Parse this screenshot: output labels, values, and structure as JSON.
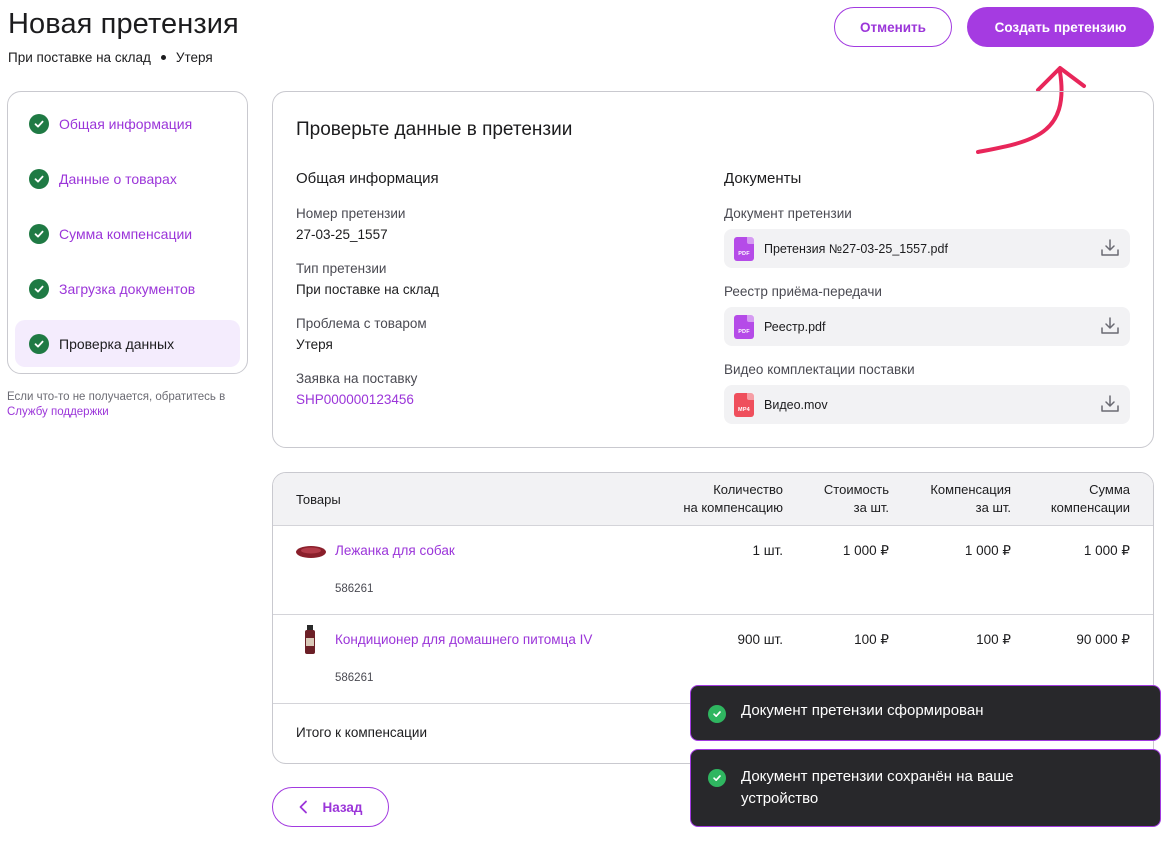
{
  "header": {
    "title": "Новая претензия",
    "subtitle_type": "При поставке на склад",
    "subtitle_problem": "Утеря",
    "cancel_label": "Отменить",
    "create_label": "Создать претензию"
  },
  "steps": [
    {
      "label": "Общая информация",
      "done": true
    },
    {
      "label": "Данные о товарах",
      "done": true
    },
    {
      "label": "Сумма компенсации",
      "done": true
    },
    {
      "label": "Загрузка документов",
      "done": true
    },
    {
      "label": "Проверка данных",
      "done": true,
      "active": true
    }
  ],
  "help": {
    "text": "Если что-то не получается, обратитесь в ",
    "link": "Службу поддержки"
  },
  "review": {
    "title": "Проверьте данные в претензии",
    "general": {
      "title": "Общая информация",
      "claim_number_label": "Номер претензии",
      "claim_number": "27-03-25_1557",
      "claim_type_label": "Тип претензии",
      "claim_type": "При поставке на склад",
      "problem_label": "Проблема с товаром",
      "problem": "Утеря",
      "supply_label": "Заявка на поставку",
      "supply": "SHP000000123456"
    },
    "documents": {
      "title": "Документы",
      "items": [
        {
          "label": "Документ претензии",
          "file": "Претензия №27-03-25_1557.pdf",
          "type": "PDF"
        },
        {
          "label": "Реестр приёма-передачи",
          "file": "Реестр.pdf",
          "type": "PDF"
        },
        {
          "label": "Видео комплектации поставки",
          "file": "Видео.mov",
          "type": "MP4"
        }
      ]
    }
  },
  "table": {
    "headers": {
      "goods": "Товары",
      "qty_1": "Количество",
      "qty_2": "на компенсацию",
      "cost_1": "Стоимость",
      "cost_2": "за шт.",
      "comp_1": "Компенсация",
      "comp_2": "за шт.",
      "sum_1": "Сумма",
      "sum_2": "компенсации"
    },
    "rows": [
      {
        "name": "Лежанка для собак",
        "sku": "586261",
        "qty": "1 шт.",
        "cost": "1 000 ₽",
        "comp": "1 000 ₽",
        "sum": "1 000 ₽"
      },
      {
        "name": "Кондиционер для домашнего питомца IV",
        "sku": "586261",
        "qty": "900 шт.",
        "cost": "100 ₽",
        "comp": "100 ₽",
        "sum": "90 000 ₽"
      }
    ],
    "total_label": "Итого к компенсации"
  },
  "back_label": "Назад",
  "toasts": [
    {
      "text": "Документ претензии сформирован"
    },
    {
      "text": "Документ претензии сохранён на ваше устройство"
    }
  ],
  "colors": {
    "accent": "#a53be1",
    "success": "#1f7a44",
    "toast_bg": "#28282b",
    "arrow": "#e8265a"
  }
}
